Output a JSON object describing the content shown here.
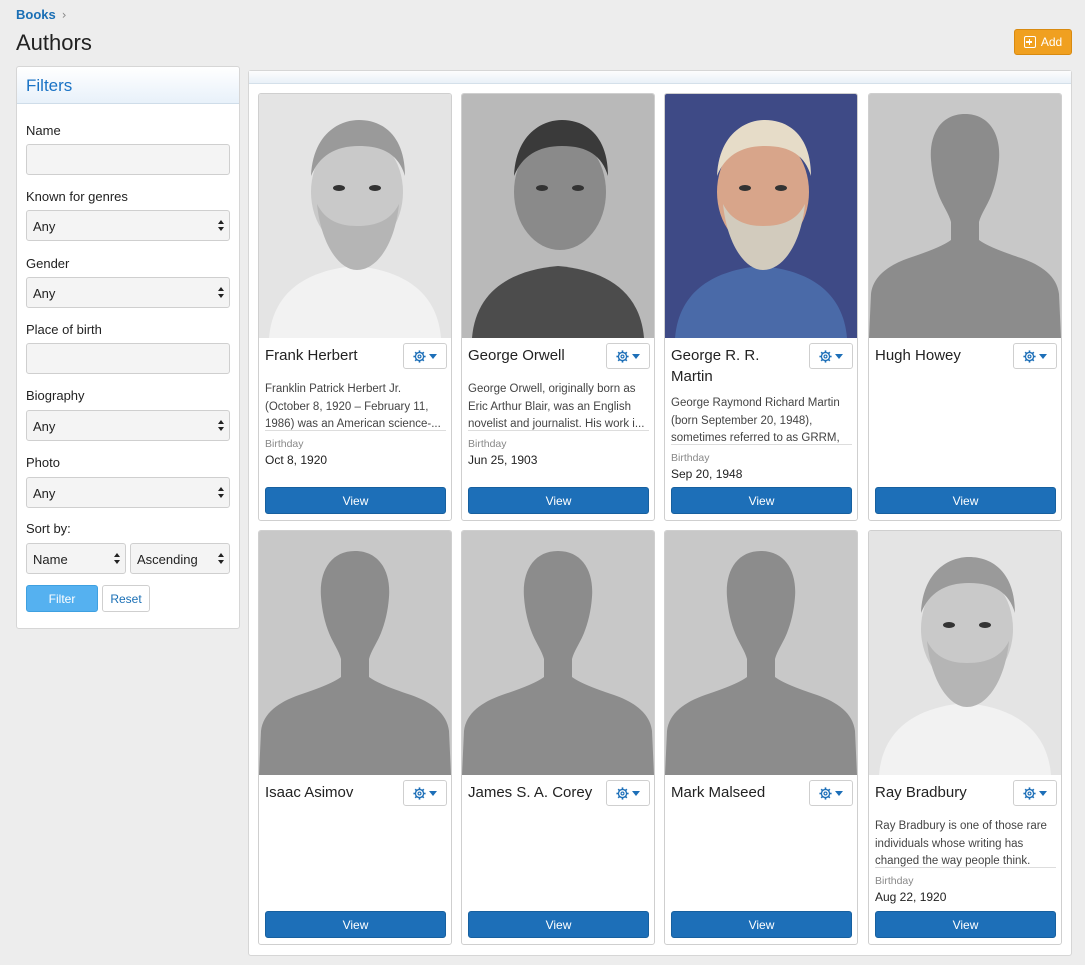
{
  "breadcrumb": {
    "books": "Books",
    "separator": "›"
  },
  "page": {
    "title": "Authors",
    "add_label": "Add"
  },
  "filters": {
    "title": "Filters",
    "name_label": "Name",
    "name_value": "",
    "genres_label": "Known for genres",
    "genres_value": "Any",
    "gender_label": "Gender",
    "gender_value": "Any",
    "place_label": "Place of birth",
    "place_value": "",
    "biography_label": "Biography",
    "biography_value": "Any",
    "photo_label": "Photo",
    "photo_value": "Any",
    "sort_label": "Sort by:",
    "sort_field_value": "Name",
    "sort_order_value": "Ascending",
    "filter_label": "Filter",
    "reset_label": "Reset"
  },
  "authors": [
    {
      "name": "Frank Herbert",
      "bio": "Franklin Patrick Herbert Jr. (October 8, 1920 – February 11, 1986) was an American science-...",
      "birthday_label": "Birthday",
      "birthday": "Oct 8, 1920",
      "view_label": "View",
      "photo": "portrait"
    },
    {
      "name": "George Orwell",
      "bio": "George Orwell, originally born as Eric Arthur Blair, was an English novelist and journalist. His work i...",
      "birthday_label": "Birthday",
      "birthday": "Jun 25, 1903",
      "view_label": "View",
      "photo": "portrait"
    },
    {
      "name": "George R. R. Martin",
      "bio": "George Raymond Richard Martin (born September 20, 1948), sometimes referred to as GRRM, i...",
      "birthday_label": "Birthday",
      "birthday": "Sep 20, 1948",
      "view_label": "View",
      "photo": "portrait-color"
    },
    {
      "name": "Hugh Howey",
      "bio": "",
      "birthday_label": "",
      "birthday": "",
      "view_label": "View",
      "photo": "placeholder"
    },
    {
      "name": "Isaac Asimov",
      "bio": "",
      "birthday_label": "",
      "birthday": "",
      "view_label": "View",
      "photo": "placeholder"
    },
    {
      "name": "James S. A. Corey",
      "bio": "",
      "birthday_label": "",
      "birthday": "",
      "view_label": "View",
      "photo": "placeholder"
    },
    {
      "name": "Mark Malseed",
      "bio": "",
      "birthday_label": "",
      "birthday": "",
      "view_label": "View",
      "photo": "placeholder"
    },
    {
      "name": "Ray Bradbury",
      "bio": "Ray Bradbury is one of those rare individuals whose writing has changed the way people think. Hi...",
      "birthday_label": "Birthday",
      "birthday": "Aug 22, 1920",
      "view_label": "View",
      "photo": "portrait"
    }
  ],
  "icons": {
    "gear": "gear-icon",
    "caret": "caret-down-icon",
    "add": "plus-square-icon"
  },
  "colors": {
    "primary": "#1d6fb8",
    "accent": "#f0a020",
    "filter_button": "#55b1f0",
    "link": "#1a6fb5"
  }
}
